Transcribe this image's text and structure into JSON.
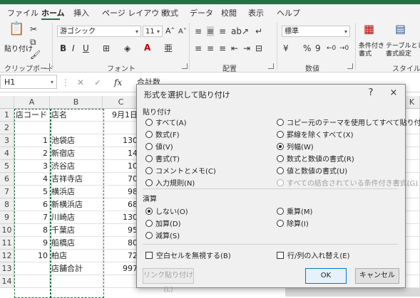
{
  "ribbon_tabs": [
    "ファイル",
    "ホーム",
    "挿入",
    "ページ レイアウト",
    "数式",
    "データ",
    "校閲",
    "表示",
    "ヘルプ"
  ],
  "ribbon": {
    "clipboard": {
      "paste_label": "貼り付け",
      "group_label": "クリップボード"
    },
    "font": {
      "font_name": "游ゴシック",
      "font_size": "11",
      "group_label": "フォント",
      "bold": "B",
      "italic": "I",
      "underline": "U"
    },
    "alignment": {
      "group_label": "配置"
    },
    "number": {
      "format": "標準",
      "percent": "%",
      "comma": "9",
      "group_label": "数値"
    },
    "styles": {
      "conditional": "条件付き\n書式",
      "table": "テーブルとして\n書式設定",
      "group_label": "スタイル"
    }
  },
  "formula_bar": {
    "name_box": "H1",
    "fx": "fx",
    "content": "合計数"
  },
  "sheet": {
    "columns": [
      "A",
      "B",
      "C"
    ],
    "extra_column": "K",
    "rows": [
      {
        "n": "1",
        "a": "店コード",
        "b": "店名",
        "c": "9月1日"
      },
      {
        "n": "2",
        "a": "",
        "b": "",
        "c": ""
      },
      {
        "n": "3",
        "a": "1",
        "b": "池袋店",
        "c": "130"
      },
      {
        "n": "4",
        "a": "2",
        "b": "新宿店",
        "c": "14"
      },
      {
        "n": "5",
        "a": "3",
        "b": "渋谷店",
        "c": "10"
      },
      {
        "n": "6",
        "a": "4",
        "b": "吉祥寺店",
        "c": "70"
      },
      {
        "n": "7",
        "a": "5",
        "b": "横浜店",
        "c": "98"
      },
      {
        "n": "8",
        "a": "6",
        "b": "新横浜店",
        "c": "68"
      },
      {
        "n": "9",
        "a": "7",
        "b": "川崎店",
        "c": "130"
      },
      {
        "n": "10",
        "a": "8",
        "b": "千葉店",
        "c": "95"
      },
      {
        "n": "11",
        "a": "9",
        "b": "船橋店",
        "c": "80"
      },
      {
        "n": "12",
        "a": "10",
        "b": "柏店",
        "c": "72"
      },
      {
        "n": "13",
        "a": "",
        "b": "店舗合計",
        "c": "997"
      },
      {
        "n": "14",
        "a": "",
        "b": "",
        "c": ""
      }
    ]
  },
  "dialog": {
    "title": "形式を選択して貼り付け",
    "help": "?",
    "close": "×",
    "paste_section": "貼り付け",
    "paste_left": [
      "すべて(A)",
      "数式(F)",
      "値(V)",
      "書式(T)",
      "コメントとメモ(C)",
      "入力規則(N)"
    ],
    "paste_right": [
      "コピー元のテーマを使用してすべて貼り付け(H)",
      "罫線を除くすべて(X)",
      "列幅(W)",
      "数式と数値の書式(R)",
      "値と数値の書式(U)",
      "すべての結合されている条件付き書式(G)"
    ],
    "op_section": "演算",
    "op_left": [
      "しない(O)",
      "加算(D)",
      "減算(S)"
    ],
    "op_right": [
      "乗算(M)",
      "除算(I)"
    ],
    "skip_blanks": "空白セルを無視する(B)",
    "transpose": "行/列の入れ替え(E)",
    "paste_link": "リンク貼り付け(L)",
    "ok": "OK",
    "cancel": "キャンセル"
  }
}
